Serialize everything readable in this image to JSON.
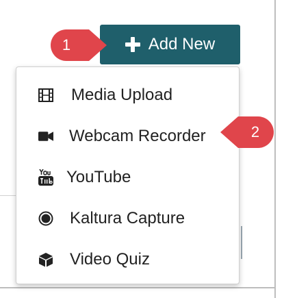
{
  "add_new_button": {
    "label": "Add New",
    "icon": "plus-icon"
  },
  "callouts": [
    {
      "number": "1",
      "color": "#e0454b"
    },
    {
      "number": "2",
      "color": "#e0454b"
    }
  ],
  "menu": {
    "items": [
      {
        "label": "Media Upload",
        "icon": "film-icon"
      },
      {
        "label": "Webcam Recorder",
        "icon": "video-camera-icon"
      },
      {
        "label": "YouTube",
        "icon": "youtube-icon"
      },
      {
        "label": "Kaltura Capture",
        "icon": "record-icon"
      },
      {
        "label": "Video Quiz",
        "icon": "cube-icon"
      }
    ]
  },
  "colors": {
    "button_bg": "#1f5f6b",
    "callout": "#e0454b",
    "text": "#222222"
  }
}
